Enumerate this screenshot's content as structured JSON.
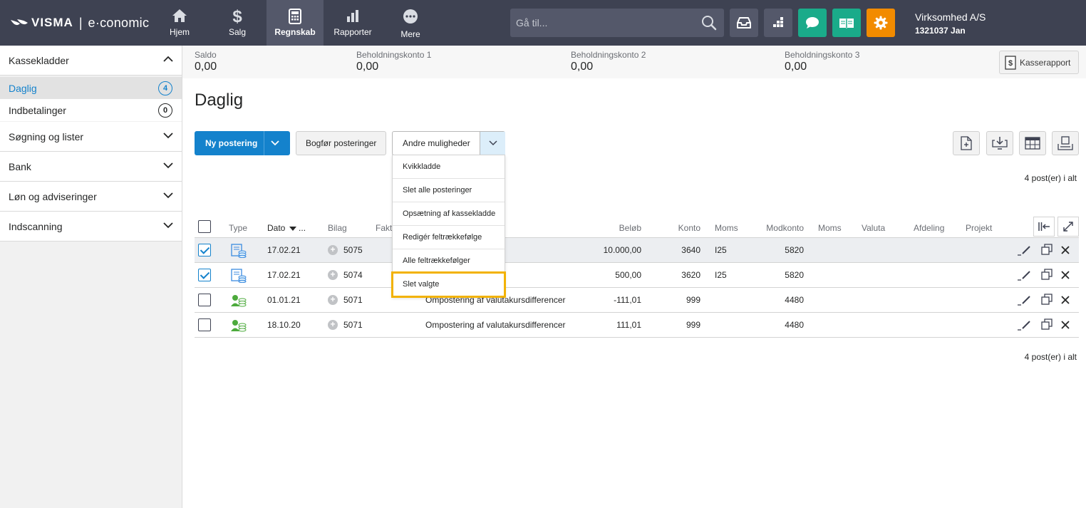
{
  "app": {
    "brand": "VISMA",
    "product": "e·conomic"
  },
  "nav": [
    {
      "label": "Hjem",
      "icon": "home-icon"
    },
    {
      "label": "Salg",
      "icon": "dollar-icon"
    },
    {
      "label": "Regnskab",
      "icon": "calculator-icon",
      "active": true
    },
    {
      "label": "Rapporter",
      "icon": "bar-chart-icon"
    },
    {
      "label": "Mere",
      "icon": "more-icon"
    }
  ],
  "search": {
    "placeholder": "Gå til..."
  },
  "toolbar_colors": {
    "inbox": "#54586a",
    "apps": "#54586a",
    "chat": "#1aab8a",
    "help": "#1aab8a",
    "settings": "#f28b00"
  },
  "company": {
    "name": "Virksomhed A/S",
    "id": "1321037 Jan"
  },
  "sidebar": {
    "sections": [
      {
        "label": "Kassekladder",
        "expanded": true
      },
      {
        "label": "Søgning og lister"
      },
      {
        "label": "Bank"
      },
      {
        "label": "Løn og adviseringer"
      },
      {
        "label": "Indscanning"
      }
    ],
    "sub": [
      {
        "label": "Daglig",
        "count": "4",
        "active": true
      },
      {
        "label": "Indbetalinger",
        "count": "0"
      }
    ]
  },
  "balances": [
    {
      "label": "Saldo",
      "value": "0,00"
    },
    {
      "label": "Beholdningskonto 1",
      "value": "0,00"
    },
    {
      "label": "Beholdningskonto 2",
      "value": "0,00"
    },
    {
      "label": "Beholdningskonto 3",
      "value": "0,00"
    }
  ],
  "kasserapport_label": "Kasserapport",
  "page_title": "Daglig",
  "buttons": {
    "new_entry": "Ny postering",
    "post_entries": "Bogfør posteringer",
    "other_options": "Andre muligheder"
  },
  "menu": [
    "Kvikkladde",
    "Slet alle posteringer",
    "Opsætning af kassekladde",
    "Redigér feltrækkefølge",
    "Alle feltrækkefølger",
    "Slet valgte"
  ],
  "highlighted_menu_item": "Slet valgte",
  "count_text": "4 post(er) i alt",
  "table": {
    "columns": {
      "type": "Type",
      "date": "Dato",
      "bilag": "Bilag",
      "faktura": "Fakt",
      "amount": "Beløb",
      "account": "Konto",
      "vat": "Moms",
      "offset": "Modkonto",
      "vat2": "Moms",
      "currency": "Valuta",
      "department": "Afdeling",
      "project": "Projekt"
    },
    "date_sort_more": "...",
    "rows": [
      {
        "checked": true,
        "type": "blue",
        "date": "17.02.21",
        "bilag": "5075",
        "text": "",
        "amount": "10.000,00",
        "account": "3640",
        "vat": "I25",
        "offset": "5820"
      },
      {
        "checked": true,
        "type": "blue",
        "date": "17.02.21",
        "bilag": "5074",
        "text": "",
        "amount": "500,00",
        "account": "3620",
        "vat": "I25",
        "offset": "5820"
      },
      {
        "checked": false,
        "type": "green",
        "date": "01.01.21",
        "bilag": "5071",
        "text": "Ompostering af valutakursdifferencer",
        "amount": "-111,01",
        "account": "999",
        "vat": "",
        "offset": "4480"
      },
      {
        "checked": false,
        "type": "green",
        "date": "18.10.20",
        "bilag": "5071",
        "text": "Ompostering af valutakursdifferencer",
        "amount": "111,01",
        "account": "999",
        "vat": "",
        "offset": "4480"
      }
    ]
  }
}
